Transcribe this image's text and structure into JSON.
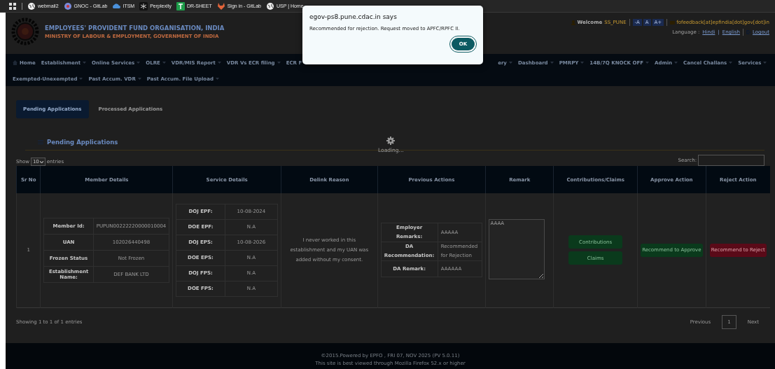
{
  "bookmarks": [
    {
      "kind": "apps"
    },
    {
      "kind": "globe",
      "label": "webmail2"
    },
    {
      "kind": "gnoc",
      "label": "GNOC - GitLab"
    },
    {
      "kind": "itsm",
      "label": "ITSM"
    },
    {
      "kind": "perplexity",
      "label": "Perplexity"
    },
    {
      "kind": "sheet",
      "label": "DR-SHEET"
    },
    {
      "kind": "gitlab",
      "label": "Sign in - GitLab"
    },
    {
      "kind": "globe",
      "label": "USP | Home"
    }
  ],
  "header": {
    "org": "EMPLOYEES' PROVIDENT FUND ORGANISATION, INDIA",
    "ministry": "MINISTRY OF LABOUR & EMPLOYMENT, GOVERNMENT OF INDIA",
    "welcome": "Welcome",
    "user": "SS_PUNE",
    "font_buttons": [
      "-A",
      "A",
      "A+"
    ],
    "email": "fofeedback[at]epfindia[dot]gov[dot]in",
    "language_label": "Language :",
    "languages": [
      "Hindi",
      "English"
    ],
    "separator": "|",
    "logout": "Logout"
  },
  "nav": {
    "home": "Home",
    "row1_left": [
      "Establishment",
      "Online Services",
      "OLRE",
      "VDR/MIS Report",
      "VDR Vs ECR filing",
      "ECR F"
    ],
    "row1_right_partial": "ery",
    "row1_right": [
      "Dashboard",
      "PMRPY",
      "14B/7Q KNOCK OFF",
      "Admin",
      "Cancel Challans",
      "Services"
    ],
    "row2": [
      "Exempted-Unexempted",
      "Past Accum. VDR",
      "Past Accum. File Upload"
    ]
  },
  "tabs": [
    {
      "label": "Pending Applications",
      "selected": true
    },
    {
      "label": "Processed Applications",
      "selected": false
    }
  ],
  "section_title": "Pending Applications",
  "length": {
    "show": "Show",
    "value": "10",
    "entries": "entries"
  },
  "search": {
    "label": "Search:"
  },
  "table": {
    "columns": [
      "Sr No",
      "Member Details",
      "Service Details",
      "Delink Reason",
      "Previous Actions",
      "Remark",
      "Contributions/Claims",
      "Approve Action",
      "Reject Action"
    ],
    "rows": [
      {
        "sr": "1",
        "member": [
          {
            "label": "Member Id:",
            "value": "PUPUN00222220000010004"
          },
          {
            "label": "UAN",
            "value": "102026440498"
          },
          {
            "label": "Frozen Status",
            "value": "Not Frozen"
          },
          {
            "label": "Establishment Name:",
            "value": "DEF BANK LTD"
          }
        ],
        "service": [
          {
            "label": "DOJ EPF:",
            "value": "10-08-2024"
          },
          {
            "label": "DOE EPF:",
            "value": "N.A"
          },
          {
            "label": "DOJ EPS:",
            "value": "10-08-2026"
          },
          {
            "label": "DOE EPS:",
            "value": "N.A"
          },
          {
            "label": "DOJ FPS:",
            "value": "N.A"
          },
          {
            "label": "DOE FPS:",
            "value": "N.A"
          }
        ],
        "reason": "I never worked in this establishment and my UAN was added without my consent.",
        "previous": [
          {
            "label": "Employer Remarks:",
            "value": "AAAAA"
          },
          {
            "label": "DA Recommendation:",
            "value": "Recommended for Rejection"
          },
          {
            "label": "DA Remark:",
            "value": "AAAAAA"
          }
        ],
        "remark": "AAAA",
        "contrib_buttons": [
          "Contributions",
          "Claims"
        ],
        "approve": "Recommend to Approve",
        "reject": "Recommend to Reject"
      }
    ]
  },
  "info": "Showing 1 to 1 of 1 entries",
  "pagination": [
    {
      "label": "Previous",
      "selected": false
    },
    {
      "label": "1",
      "selected": true
    },
    {
      "label": "Next",
      "selected": false
    }
  ],
  "loading": "Loading...",
  "footer": [
    "©2015.Powered by EPFO , FRI 07, NOV 2025 (PV 5.0.11)",
    "This site is best viewed through Mozilla Firefox 52.x or higher"
  ],
  "dialog": {
    "title": "egov-ps8.pune.cdac.in says",
    "message": "Recommended for rejection. Request moved to APFC/RPFC II.",
    "button": "OK"
  }
}
